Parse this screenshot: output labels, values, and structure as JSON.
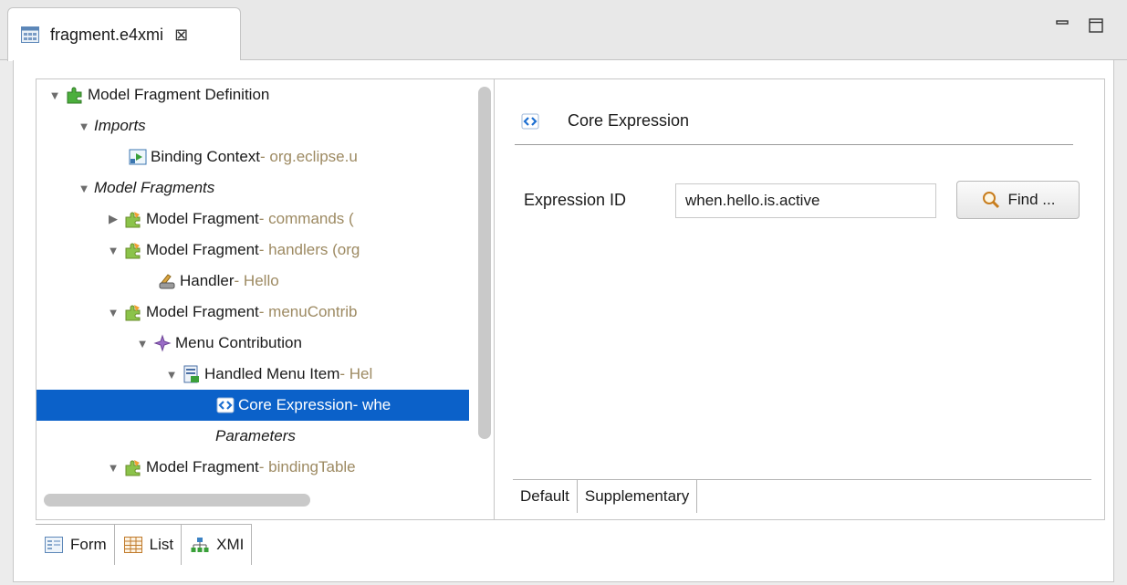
{
  "editor_tab": {
    "title": "fragment.e4xmi",
    "close": "⊠"
  },
  "tree": {
    "rows": [
      {
        "label": "Model Fragment Definition",
        "extra": ""
      },
      {
        "label": "Imports",
        "extra": ""
      },
      {
        "label": "Binding Context",
        "extra": " - org.eclipse.u"
      },
      {
        "label": "Model Fragments",
        "extra": ""
      },
      {
        "label": "Model Fragment",
        "extra": " - commands ("
      },
      {
        "label": "Model Fragment",
        "extra": " - handlers (org"
      },
      {
        "label": "Handler",
        "extra": " - Hello"
      },
      {
        "label": "Model Fragment",
        "extra": " - menuContrib"
      },
      {
        "label": "Menu Contribution",
        "extra": ""
      },
      {
        "label": "Handled Menu Item",
        "extra": " - Hel"
      },
      {
        "label": "Core Expression",
        "extra": " - whe"
      },
      {
        "label": "Parameters",
        "extra": ""
      },
      {
        "label": "Model Fragment",
        "extra": " - bindingTable"
      }
    ]
  },
  "detail": {
    "title": "Core Expression",
    "expression_label": "Expression ID",
    "expression_value": "when.hello.is.active",
    "find_label": "Find ...",
    "tabs": [
      "Default",
      "Supplementary"
    ]
  },
  "bottom_tabs": [
    "Form",
    "List",
    "XMI"
  ],
  "colors": {
    "selection": "#0b61c9",
    "extra_text": "#9d8a62"
  }
}
